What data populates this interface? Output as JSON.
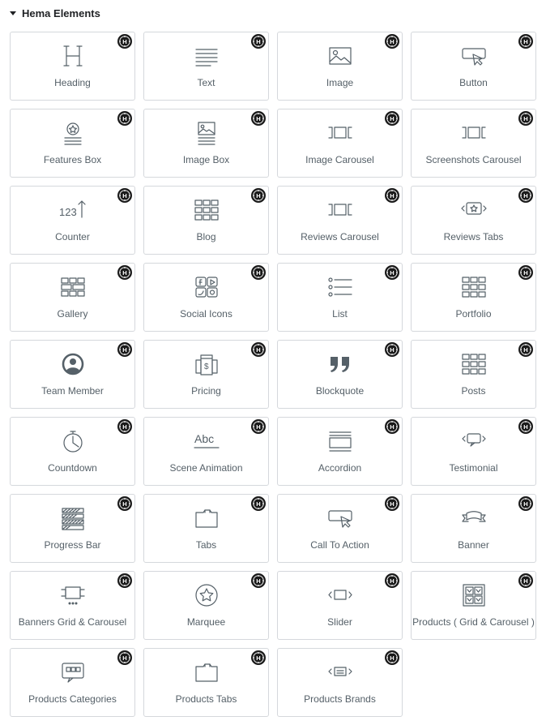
{
  "section": {
    "title": "Hema Elements"
  },
  "widgets": [
    {
      "label": "Heading",
      "icon": "heading-icon"
    },
    {
      "label": "Text",
      "icon": "text-icon"
    },
    {
      "label": "Image",
      "icon": "image-icon"
    },
    {
      "label": "Button",
      "icon": "button-icon"
    },
    {
      "label": "Features Box",
      "icon": "features-box-icon"
    },
    {
      "label": "Image Box",
      "icon": "image-box-icon"
    },
    {
      "label": "Image Carousel",
      "icon": "image-carousel-icon"
    },
    {
      "label": "Screenshots Carousel",
      "icon": "screenshots-carousel-icon"
    },
    {
      "label": "Counter",
      "icon": "counter-icon"
    },
    {
      "label": "Blog",
      "icon": "blog-icon"
    },
    {
      "label": "Reviews Carousel",
      "icon": "reviews-carousel-icon"
    },
    {
      "label": "Reviews Tabs",
      "icon": "reviews-tabs-icon"
    },
    {
      "label": "Gallery",
      "icon": "gallery-icon"
    },
    {
      "label": "Social Icons",
      "icon": "social-icons-icon"
    },
    {
      "label": "List",
      "icon": "list-icon"
    },
    {
      "label": "Portfolio",
      "icon": "portfolio-icon"
    },
    {
      "label": "Team Member",
      "icon": "team-member-icon"
    },
    {
      "label": "Pricing",
      "icon": "pricing-icon"
    },
    {
      "label": "Blockquote",
      "icon": "blockquote-icon"
    },
    {
      "label": "Posts",
      "icon": "posts-icon"
    },
    {
      "label": "Countdown",
      "icon": "countdown-icon"
    },
    {
      "label": "Scene Animation",
      "icon": "scene-animation-icon"
    },
    {
      "label": "Accordion",
      "icon": "accordion-icon"
    },
    {
      "label": "Testimonial",
      "icon": "testimonial-icon"
    },
    {
      "label": "Progress Bar",
      "icon": "progress-bar-icon"
    },
    {
      "label": "Tabs",
      "icon": "tabs-icon"
    },
    {
      "label": "Call To Action",
      "icon": "call-to-action-icon"
    },
    {
      "label": "Banner",
      "icon": "banner-icon"
    },
    {
      "label": "Banners Grid & Carousel",
      "icon": "banners-grid-carousel-icon"
    },
    {
      "label": "Marquee",
      "icon": "marquee-icon"
    },
    {
      "label": "Slider",
      "icon": "slider-icon"
    },
    {
      "label": "Products ( Grid & Carousel )",
      "icon": "products-grid-carousel-icon"
    },
    {
      "label": "Products Categories",
      "icon": "products-categories-icon"
    },
    {
      "label": "Products Tabs",
      "icon": "products-tabs-icon"
    },
    {
      "label": "Products Brands",
      "icon": "products-brands-icon"
    }
  ],
  "badge": {
    "letter": "H",
    "icon": "hema-badge-icon"
  },
  "colors": {
    "icon": "#556068",
    "label": "#556068",
    "border": "#d5d8dc",
    "badge": "#1a1a1a"
  }
}
